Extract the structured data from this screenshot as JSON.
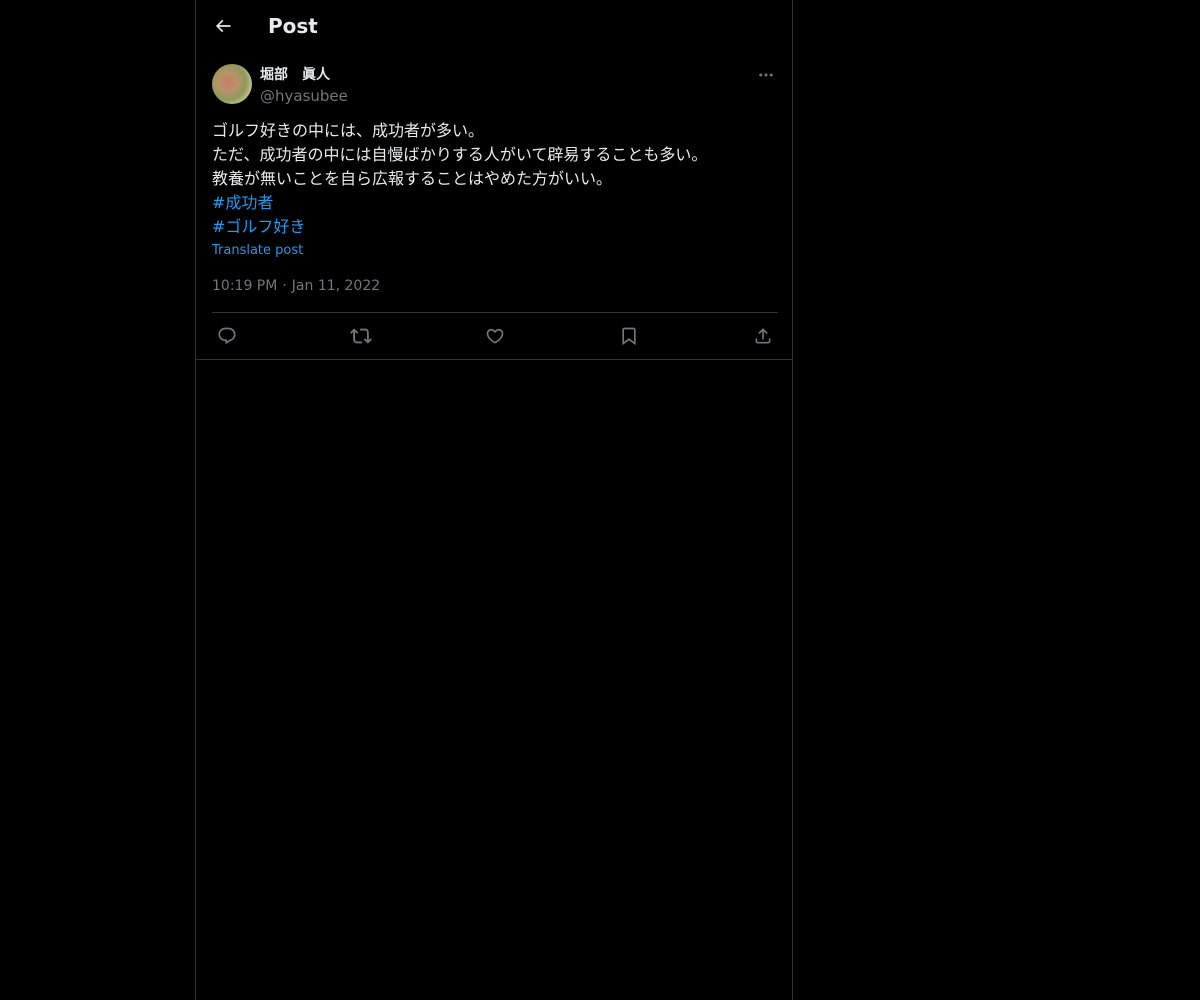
{
  "header": {
    "title": "Post",
    "back_icon": "arrow-left-icon"
  },
  "post": {
    "author": {
      "name": "堀部　眞人",
      "handle": "@hyasubee",
      "avatar_icon": "avatar"
    },
    "more_icon": "more-horizontal-icon",
    "text_lines": [
      "ゴルフ好きの中には、成功者が多い。",
      "ただ、成功者の中には自慢ばかりする人がいて辟易することも多い。",
      "教養が無いことを自ら広報することはやめた方がいい。"
    ],
    "hashtags": [
      "#成功者",
      "#ゴルフ好き"
    ],
    "translate_label": "Translate post",
    "time": "10:19 PM",
    "separator": "·",
    "date": "Jan 11, 2022"
  },
  "actions": [
    {
      "icon": "reply-icon"
    },
    {
      "icon": "repost-icon"
    },
    {
      "icon": "like-icon"
    },
    {
      "icon": "bookmark-icon"
    },
    {
      "icon": "share-icon"
    }
  ],
  "colors": {
    "background": "#000000",
    "text": "#e7e9ea",
    "secondary_text": "#71767b",
    "accent": "#1d9bf0",
    "border": "#2f3336"
  }
}
